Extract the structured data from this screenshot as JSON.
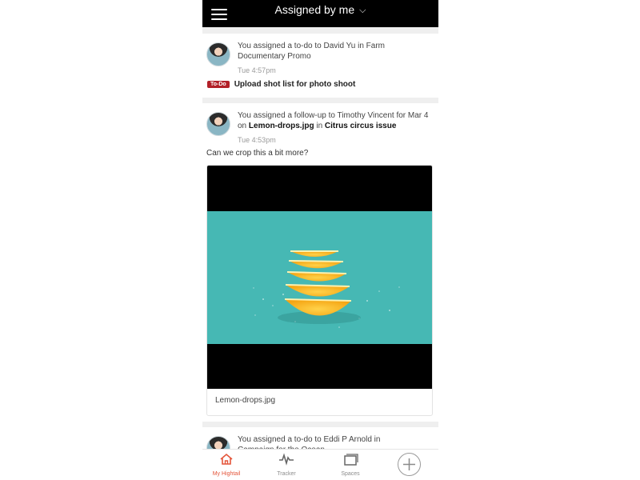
{
  "header": {
    "title": "Assigned by me"
  },
  "feed": [
    {
      "type": "todo",
      "message_parts": [
        "You assigned a to-do to David Yu in Farm Documentary Promo"
      ],
      "time": "Tue 4:57pm",
      "badge": "To-Do",
      "task": "Upload shot list for photo shoot"
    },
    {
      "type": "follow-up",
      "message_a": "You assigned a follow-up to Timothy Vincent for Mar 4 on ",
      "message_b": "Lemon-drops.jpg",
      "message_c": " in ",
      "message_d": "Citrus circus issue",
      "time": "Tue 4:53pm",
      "comment": "Can we crop this a bit more?",
      "attachment_name": "Lemon-drops.jpg"
    },
    {
      "type": "todo",
      "message_a": "You assigned a to-do to Eddi P Arnold in",
      "message_b": "Campaign for the Ocean"
    }
  ],
  "bottom_nav": [
    {
      "label": "My Hightail",
      "icon": "home-icon",
      "active": true
    },
    {
      "label": "Tracker",
      "icon": "activity-icon",
      "active": false
    },
    {
      "label": "Spaces",
      "icon": "spaces-icon",
      "active": false
    }
  ],
  "colors": {
    "accent": "#e4553a",
    "todo_badge": "#b22028",
    "photo_bg": "#46b8b4"
  }
}
